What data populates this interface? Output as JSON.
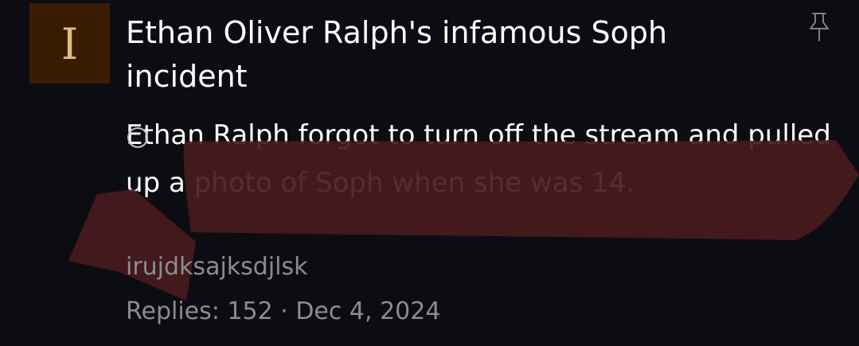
{
  "thread": {
    "avatar_letter": "I",
    "title": "Ethan Oliver Ralph's infamous Soph incident",
    "snippet": "Ethan Ralph forgot to turn off the stream and pulled up a photo of Soph when she was 14.",
    "author": "irujdksajksdjlsk",
    "replies_label": "Replies:",
    "replies_count": "152",
    "separator": "·",
    "date": "Dec 4, 2024",
    "pin_icon": "pin-icon"
  },
  "colors": {
    "background": "#0c0d12",
    "avatar_bg": "#3a1c03",
    "avatar_letter": "#e2bd88",
    "muted_text": "#8a8c93",
    "scribble": "#4a1a1d"
  }
}
